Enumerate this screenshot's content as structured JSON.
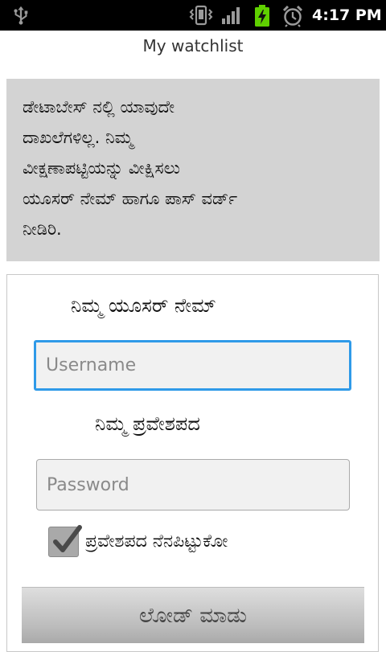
{
  "status_bar": {
    "time": "4:17 PM",
    "icons": [
      "usb-icon",
      "vibrate-icon",
      "signal-icon",
      "battery-charging-icon",
      "alarm-icon"
    ]
  },
  "header": {
    "title": "My watchlist"
  },
  "message": {
    "lines": [
      "ಡೇಟಾಬೇಸ್ ನಲ್ಲಿ ಯಾವುದೇ",
      "ದಾಖಲೆಗಳಿಲ್ಲ. ನಿಮ್ಮ",
      "ವೀಕ್ಷಣಾಪಟ್ಟಿಯನ್ನು ವೀಕ್ಷಿಸಲು",
      "ಯೂಸರ್ ನೇಮ್ ಹಾಗೂ ಪಾಸ್ ವರ್ಡ್",
      "ನೀಡಿರಿ."
    ]
  },
  "form": {
    "username_label": "ನಿಮ್ಮ ಯೂಸರ್ ನೇಮ್",
    "username_placeholder": "Username",
    "username_value": "",
    "password_label": "ನಿಮ್ಮ ಪ್ರವೇಶಪದ",
    "password_placeholder": "Password",
    "password_value": "",
    "remember_label": "ಪ್ರವೇಶಪದ ನೆನಪಿಟ್ಟುಕೋ",
    "remember_checked": true,
    "submit_label": "ಲೋಡ್ ಮಾಡು"
  },
  "colors": {
    "status_bar": "#000000",
    "message_bg": "#d3d3d3",
    "focus_border": "#2f9ae8",
    "battery_green": "#5fd000"
  }
}
